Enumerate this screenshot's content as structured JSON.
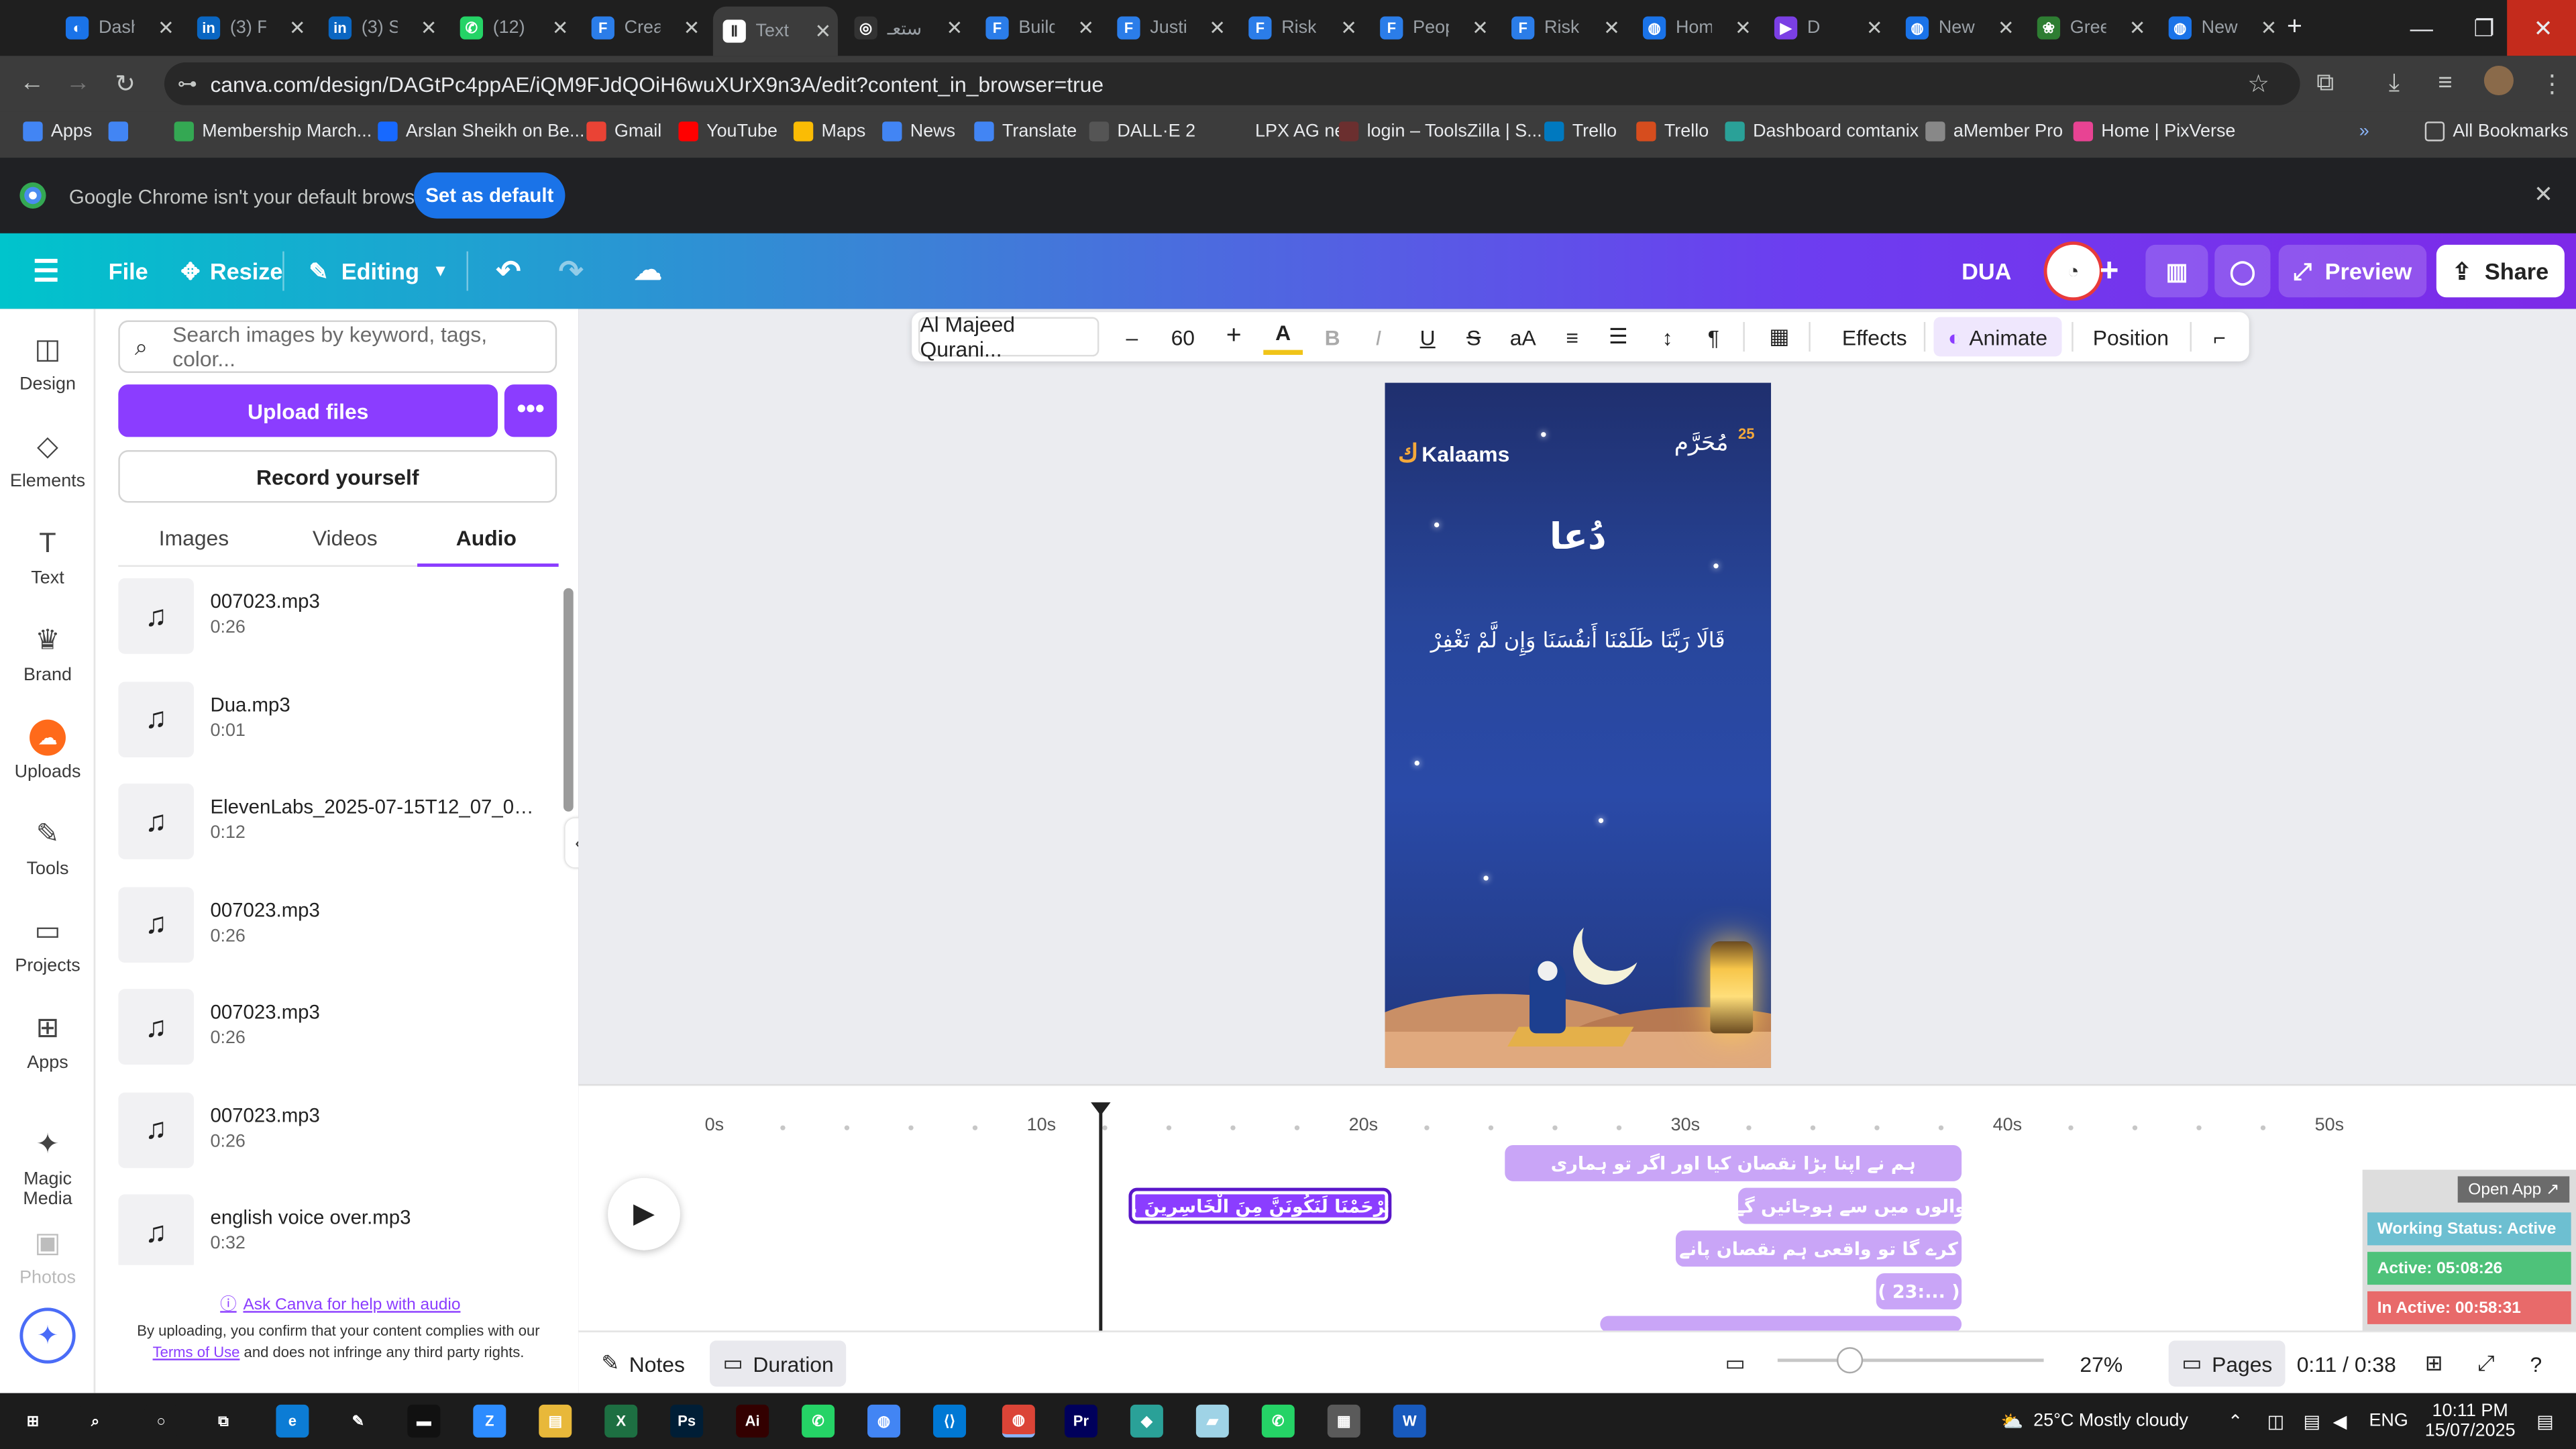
{
  "browser": {
    "tabs": [
      {
        "label": "Dash",
        "color": "#1a73e8",
        "glyph": "◐"
      },
      {
        "label": "(3) Fe",
        "color": "#0a66c2",
        "glyph": "in"
      },
      {
        "label": "(3) Se",
        "color": "#0a66c2",
        "glyph": "in"
      },
      {
        "label": "(12)",
        "color": "#25d366",
        "glyph": "✆"
      },
      {
        "label": "Creat",
        "color": "#2b7de9",
        "glyph": "F"
      },
      {
        "label": "Text",
        "color": "#ffffff",
        "glyph": "Ⅱ"
      },
      {
        "label": "استعـ",
        "color": "#333333",
        "glyph": "◎"
      },
      {
        "label": "Build",
        "color": "#2b7de9",
        "glyph": "F"
      },
      {
        "label": "Justi",
        "color": "#2b7de9",
        "glyph": "F"
      },
      {
        "label": "Risk",
        "color": "#2b7de9",
        "glyph": "F"
      },
      {
        "label": "Peop",
        "color": "#2b7de9",
        "glyph": "F"
      },
      {
        "label": "Risk",
        "color": "#2b7de9",
        "glyph": "F"
      },
      {
        "label": "Hom",
        "color": "#1a73e8",
        "glyph": "◍"
      },
      {
        "label": "D",
        "color": "#7b3fe4",
        "glyph": "▶"
      },
      {
        "label": "New",
        "color": "#1a73e8",
        "glyph": "◍"
      },
      {
        "label": "Gree",
        "color": "#2e7d32",
        "glyph": "❀"
      },
      {
        "label": "New",
        "color": "#1a73e8",
        "glyph": "◍"
      }
    ],
    "new_tab": "+",
    "url": "canva.com/design/DAGtPc4ppAE/iQM9FJdQOiH6wuXUrX9n3A/edit?content_in_browser=true",
    "bookmarks": [
      {
        "label": "Apps",
        "color": "#4285f4"
      },
      {
        "label": "",
        "color": "#4285f4"
      },
      {
        "label": "Membership March...",
        "color": "#34a853"
      },
      {
        "label": "Arslan Sheikh on Be...",
        "color": "#1769ff"
      },
      {
        "label": "Gmail",
        "color": "#ea4335"
      },
      {
        "label": "YouTube",
        "color": "#ff0000"
      },
      {
        "label": "Maps",
        "color": "#fbbc04"
      },
      {
        "label": "News",
        "color": "#4285f4"
      },
      {
        "label": "Translate",
        "color": "#4285f4"
      },
      {
        "label": "DALL·E 2",
        "color": "#555555"
      },
      {
        "label": "LPX AG new",
        "color": "#3c3c3c"
      },
      {
        "label": "login – ToolsZilla | S...",
        "color": "#6b2f2f"
      },
      {
        "label": "Trello",
        "color": "#0079bf"
      },
      {
        "label": "Trello",
        "color": "#d64d1e"
      },
      {
        "label": "Dashboard comtanix",
        "color": "#2aa198"
      },
      {
        "label": "aMember Pro",
        "color": "#888888"
      },
      {
        "label": "Home | PixVerse",
        "color": "#e84393"
      }
    ],
    "all_bookmarks": "All Bookmarks",
    "default_msg": "Google Chrome isn't your default browser",
    "default_btn": "Set as default"
  },
  "canva": {
    "header": {
      "file": "File",
      "resize": "Resize",
      "editing": "Editing",
      "design_title": "DUA",
      "preview": "Preview",
      "share": "Share"
    },
    "rail": [
      {
        "label": "Design",
        "icon": "◫"
      },
      {
        "label": "Elements",
        "icon": "◇"
      },
      {
        "label": "Text",
        "icon": "T"
      },
      {
        "label": "Brand",
        "icon": "♛"
      },
      {
        "label": "Uploads",
        "icon": "☁"
      },
      {
        "label": "Tools",
        "icon": "✎"
      },
      {
        "label": "Projects",
        "icon": "▭"
      },
      {
        "label": "Apps",
        "icon": "⊞"
      },
      {
        "label": "Magic Media",
        "icon": "✦"
      },
      {
        "label": "Photos",
        "icon": "▣"
      }
    ],
    "panel": {
      "search_placeholder": "Search images by keyword, tags, color...",
      "upload": "Upload files",
      "record": "Record yourself",
      "tabs": [
        "Images",
        "Videos",
        "Audio"
      ],
      "active_tab": "Audio",
      "audio": [
        {
          "name": "007023.mp3",
          "duration": "0:26"
        },
        {
          "name": "Dua.mp3",
          "duration": "0:01"
        },
        {
          "name": "ElevenLabs_2025-07-15T12_07_02_...",
          "duration": "0:12"
        },
        {
          "name": "007023.mp3",
          "duration": "0:26"
        },
        {
          "name": "007023.mp3",
          "duration": "0:26"
        },
        {
          "name": "007023.mp3",
          "duration": "0:26"
        },
        {
          "name": "english voice over.mp3",
          "duration": "0:32"
        }
      ],
      "help": "Ask Canva for help with audio",
      "terms_1": "By uploading, you confirm that your content complies with our",
      "terms_link": "Terms of Use",
      "terms_2": "and does not infringe any third party rights."
    },
    "toolbar": {
      "font": "Al Majeed Qurani...",
      "size": "60",
      "effects": "Effects",
      "animate": "Animate",
      "position": "Position"
    },
    "design": {
      "brand": "Kalaams",
      "month": "مُحَرَّم",
      "month_num": "25",
      "title": "دُعا",
      "ayah": "قَالَا رَبَّنَا ظَلَمْنَا أَنفُسَنَا وَإِن لَّمْ تَغْفِرْ"
    },
    "timeline": {
      "ticks": [
        "0s",
        "10s",
        "20s",
        "30s",
        "40s",
        "50s"
      ],
      "clips": [
        {
          "text": "ہم نے اپنا بڑا نقصان کیا اور اگر تو ہماری",
          "selected": false
        },
        {
          "text": "... وَتَرْحَمْنَا لَنَكُونَنَّ مِنَ الْخَاسِرِينَ",
          "selected": true
        },
        {
          "text": "والوں میں سے ہوجائیں گے",
          "selected": false
        },
        {
          "text": "کرے گا تو واقعی ہم نقصان پانے",
          "selected": false
        },
        {
          "text": "( 23:... )",
          "selected": false
        }
      ]
    },
    "bottom": {
      "notes": "Notes",
      "duration": "Duration",
      "zoom": "27%",
      "pages": "Pages",
      "time": "0:11 / 0:38"
    },
    "status_widget": {
      "open_app": "Open App ↗",
      "working": "Working Status: Active",
      "active": "Active: 05:08:26",
      "inactive": "In Active: 00:58:31",
      "colors": {
        "working": "#6dbfd1",
        "active": "#4ec27a",
        "inactive": "#e86a6a"
      }
    }
  },
  "taskbar": {
    "apps": [
      {
        "glyph": "⊞",
        "color": "#1c1c1c"
      },
      {
        "glyph": "⌕",
        "color": "#1c1c1c"
      },
      {
        "glyph": "○",
        "color": "#1c1c1c"
      },
      {
        "glyph": "⧉",
        "color": "#1c1c1c"
      },
      {
        "glyph": "e",
        "color": "#0c7cd5"
      },
      {
        "glyph": "✎",
        "color": "#1c1c1c"
      },
      {
        "glyph": "▬",
        "color": "#111111"
      },
      {
        "glyph": "Z",
        "color": "#2d8cff"
      },
      {
        "glyph": "▤",
        "color": "#e8b83a"
      },
      {
        "glyph": "X",
        "color": "#1d6f42"
      },
      {
        "glyph": "Ps",
        "color": "#001e36"
      },
      {
        "glyph": "Ai",
        "color": "#330000"
      },
      {
        "glyph": "✆",
        "color": "#25d366"
      },
      {
        "glyph": "◍",
        "color": "#4285f4"
      },
      {
        "glyph": "⟨⟩",
        "color": "#0078d4"
      },
      {
        "glyph": "◍",
        "color": "#db4437"
      },
      {
        "glyph": "Pr",
        "color": "#00005b"
      },
      {
        "glyph": "◆",
        "color": "#2aa198"
      },
      {
        "glyph": "▰",
        "color": "#9fd3e6"
      },
      {
        "glyph": "✆",
        "color": "#25d366"
      },
      {
        "glyph": "▦",
        "color": "#5a5a5a"
      },
      {
        "glyph": "W",
        "color": "#185abd"
      }
    ],
    "weather": "25°C Mostly cloudy",
    "lang": "ENG",
    "time": "10:11 PM",
    "date": "15/07/2025"
  }
}
